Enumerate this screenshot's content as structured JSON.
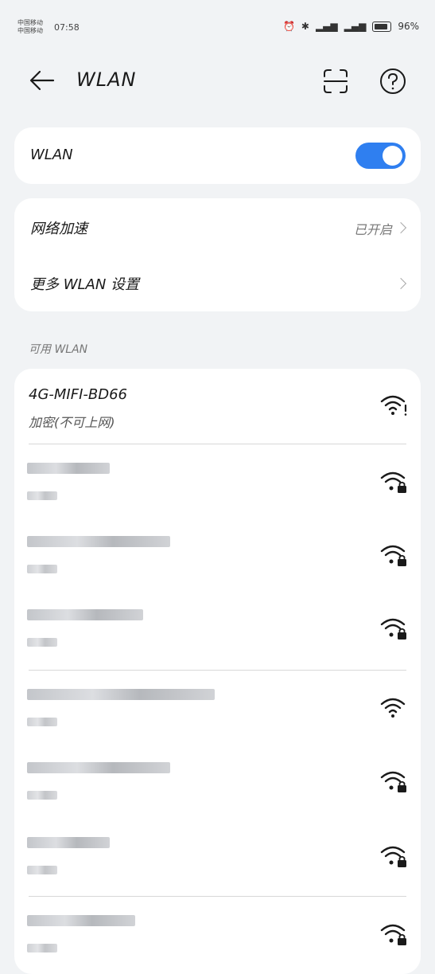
{
  "status_bar": {
    "carrier_lines": [
      "中国移动",
      "中国移动"
    ],
    "time": "07:58",
    "battery": "96%"
  },
  "header": {
    "title": "WLAN"
  },
  "wlan_card": {
    "label": "WLAN",
    "enabled": true
  },
  "settings": {
    "accelerate_label": "网络加速",
    "accelerate_value": "已开启",
    "more_label": "更多 WLAN 设置"
  },
  "available_header": "可用 WLAN",
  "networks": [
    {
      "name": "4G-MIFI-BD66",
      "status": "加密(不可上网)",
      "icon": "wifi-alert-icon",
      "secured": true
    }
  ],
  "icons": {
    "accent": "#2f7ff0",
    "background": "#f1f3f5"
  }
}
